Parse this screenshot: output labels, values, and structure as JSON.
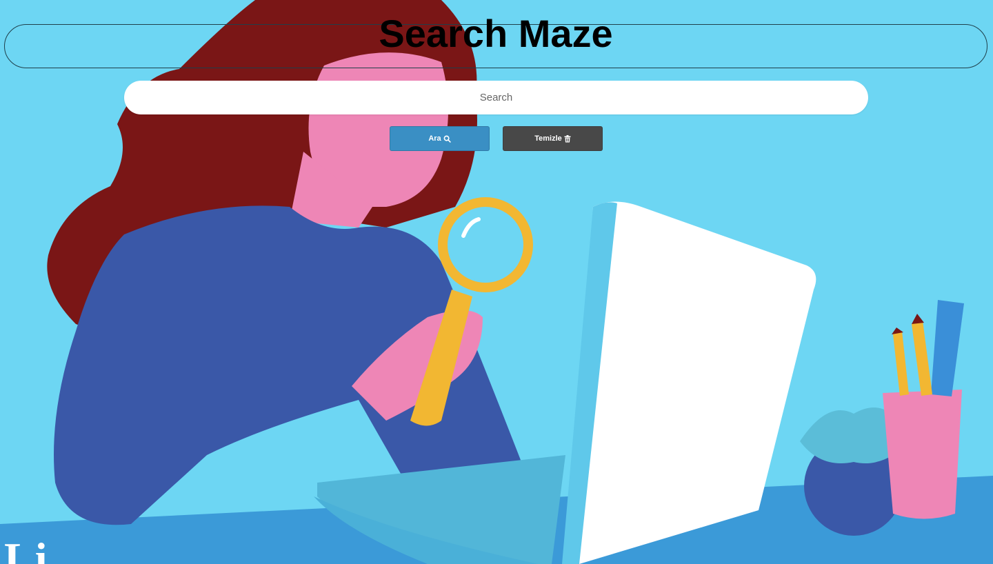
{
  "header": {
    "title": "Search Maze"
  },
  "search": {
    "placeholder": "Search",
    "value": ""
  },
  "actions": {
    "search_label": "Ara",
    "search_icon": "magnifier-icon",
    "clear_label": "Temizle",
    "clear_icon": "trash-icon"
  },
  "colors": {
    "background": "#6dd6f3",
    "search_button": "#3a8fc4",
    "clear_button": "#484848"
  },
  "corner_logo": {
    "text": "Li"
  }
}
